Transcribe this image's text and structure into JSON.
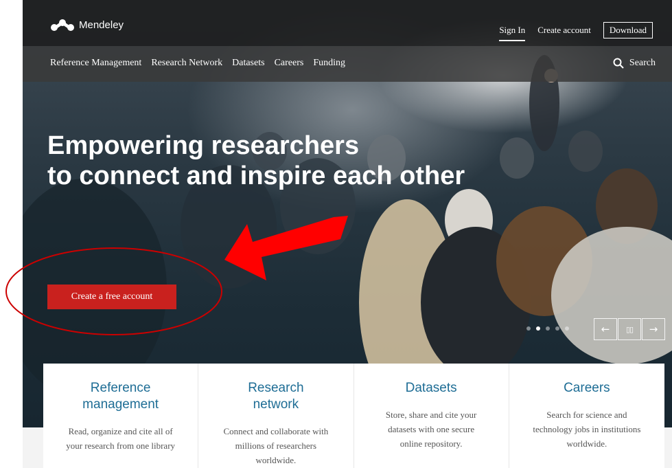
{
  "header": {
    "brand": "Mendeley",
    "links": {
      "sign_in": "Sign In",
      "create_account": "Create account",
      "download": "Download"
    }
  },
  "nav": {
    "items": [
      {
        "label": "Reference Management"
      },
      {
        "label": "Research Network"
      },
      {
        "label": "Datasets"
      },
      {
        "label": "Careers"
      },
      {
        "label": "Funding"
      }
    ],
    "search_label": "Search"
  },
  "hero": {
    "headline_line1": "Empowering researchers",
    "headline_line2": "to connect and inspire each other",
    "cta_label": "Create a free account",
    "carousel": {
      "slide_count": 5,
      "active_slide": 2,
      "prev_icon": "←",
      "pause_icon": "▯▯",
      "next_icon": "→"
    }
  },
  "features": [
    {
      "title": "Reference management",
      "text": "Read, organize and cite all of your research from one library"
    },
    {
      "title": "Research network",
      "text": "Connect and collaborate with millions of researchers worldwide."
    },
    {
      "title": "Datasets",
      "text": "Store, share and cite your datasets with one secure online repository."
    },
    {
      "title": "Careers",
      "text": "Search for science and technology jobs in institutions worldwide."
    }
  ],
  "annotation": {
    "arrow_color": "#ff0000",
    "ellipse_color": "#cc0000"
  }
}
